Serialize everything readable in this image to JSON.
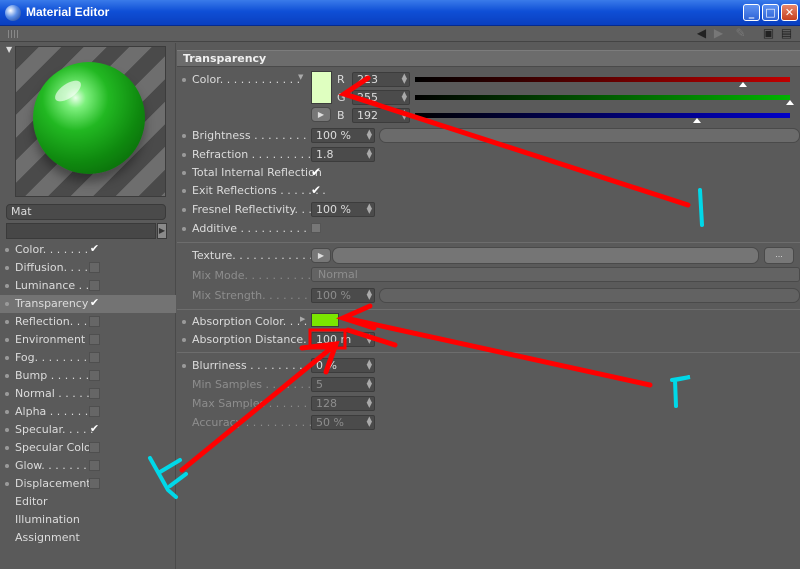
{
  "window": {
    "title": "Material Editor",
    "controls": [
      "minimize-icon",
      "maximize-icon",
      "close-icon"
    ]
  },
  "toolbar": {
    "icons": [
      "arrow-left-icon",
      "arrow-right-icon",
      "edit-icon",
      "lock-icon",
      "menu-icon"
    ]
  },
  "material": {
    "name": "Mat"
  },
  "channels": [
    {
      "label": "Color. . . . . . . ",
      "checked": true
    },
    {
      "label": "Diffusion. . . . .",
      "checked": false
    },
    {
      "label": "Luminance . . .",
      "checked": false
    },
    {
      "label": "Transparency",
      "checked": true,
      "active": true
    },
    {
      "label": "Reflection. . . .",
      "checked": false
    },
    {
      "label": "Environment",
      "checked": false
    },
    {
      "label": "Fog. . . . . . . .",
      "checked": false
    },
    {
      "label": "Bump . . . . . .",
      "checked": false
    },
    {
      "label": "Normal . . . . .",
      "checked": false
    },
    {
      "label": "Alpha . . . . . .",
      "checked": false
    },
    {
      "label": "Specular. . . . .",
      "checked": true
    },
    {
      "label": "Specular Color",
      "checked": false
    },
    {
      "label": "Glow. . . . . . .",
      "checked": false
    },
    {
      "label": "Displacement",
      "checked": false
    },
    {
      "label": "Editor",
      "checked": null
    },
    {
      "label": "Illumination",
      "checked": null
    },
    {
      "label": "Assignment",
      "checked": null
    }
  ],
  "transparency": {
    "title": "Transparency",
    "color": {
      "label": "Color. . . . . . . . . . . .",
      "swatch": "#dfffc0",
      "channels": [
        {
          "key": "R",
          "value": "223",
          "level": 0.875,
          "color": "#c00000"
        },
        {
          "key": "G",
          "value": "255",
          "level": 1.0,
          "color": "#00b400"
        },
        {
          "key": "B",
          "value": "192",
          "level": 0.753,
          "color": "#0000c8"
        }
      ]
    },
    "brightness": {
      "label": "Brightness . . . . . . . . . .",
      "value": "100 %"
    },
    "refraction": {
      "label": "Refraction . . . . . . . . . .",
      "value": "1.8"
    },
    "total_internal_reflection": {
      "label": "Total Internal Reflection",
      "checked": true
    },
    "exit_reflections": {
      "label": "Exit Reflections . . . . . . .",
      "checked": true
    },
    "fresnel_reflectivity": {
      "label": "Fresnel Reflectivity. . . .",
      "value": "100 %"
    },
    "additive": {
      "label": "Additive . . . . . . . . . . . .",
      "checked": false
    },
    "texture": {
      "label": "Texture. . . . . . . . . . . . .",
      "more": "..."
    },
    "mix_mode": {
      "label": "Mix Mode. . . . . . . . . . . .",
      "value": "Normal"
    },
    "mix_strength": {
      "label": "Mix Strength. . . . . . . . . .",
      "value": "100 %"
    },
    "absorption_color": {
      "label": "Absorption Color. . . . . . .",
      "swatch": "#7be600"
    },
    "absorption_distance": {
      "label": "Absorption Distance. . . .",
      "value": "100 m"
    },
    "blurriness": {
      "label": "Blurriness . . . . . . . . . .",
      "value": "0 %"
    },
    "min_samples": {
      "label": "Min Samples . . . . . . . . .",
      "value": "5"
    },
    "max_samples": {
      "label": "Max Samples . . . . . . . . .",
      "value": "128"
    },
    "accuracy": {
      "label": "Accuracy . . . . . . . . . . . .",
      "value": "50 %"
    }
  },
  "annotations": [
    {
      "label": "1",
      "color": "#ff0000"
    },
    {
      "label": "2",
      "color": "#ff0000"
    },
    {
      "label": "3",
      "color": "#ff0000"
    }
  ],
  "colors": {
    "accent": "#ff0000",
    "annotation_text": "#00d8e8"
  }
}
